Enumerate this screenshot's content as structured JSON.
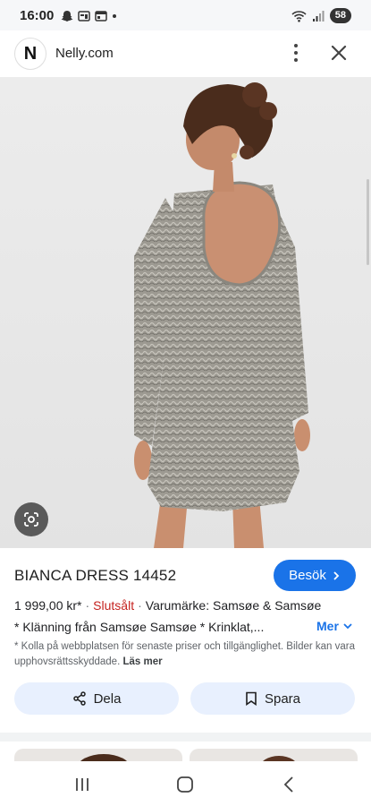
{
  "status_bar": {
    "time": "16:00",
    "battery": "58"
  },
  "site": {
    "logo_letter": "N",
    "name": "Nelly.com"
  },
  "product": {
    "title": "BIANCA DRESS 14452",
    "price": "1 999,00 kr*",
    "stock_status": "Slutsålt",
    "brand": "Varumärke: Samsøe & Samsøe",
    "description": "* Klänning från Samsøe Samsøe * Krinklat,...",
    "disclaimer": "* Kolla på webbplatsen för senaste priser och tillgänglighet. Bilder kan vara upphovsrättsskyddade.",
    "read_more": "Läs mer"
  },
  "buttons": {
    "visit": "Besök",
    "more": "Mer",
    "share": "Dela",
    "save": "Spara"
  },
  "colors": {
    "accent": "#1a73e8",
    "sold_out": "#c5221f",
    "action_bg": "#e8f0fe"
  },
  "icons": [
    "snapchat-icon",
    "gallery-icon",
    "calendar-icon",
    "wifi-icon",
    "signal-icon",
    "kebab-menu-icon",
    "close-icon",
    "lens-icon",
    "chevron-right-icon",
    "chevron-down-icon",
    "share-icon",
    "bookmark-icon",
    "recents-icon",
    "home-icon",
    "back-icon"
  ]
}
